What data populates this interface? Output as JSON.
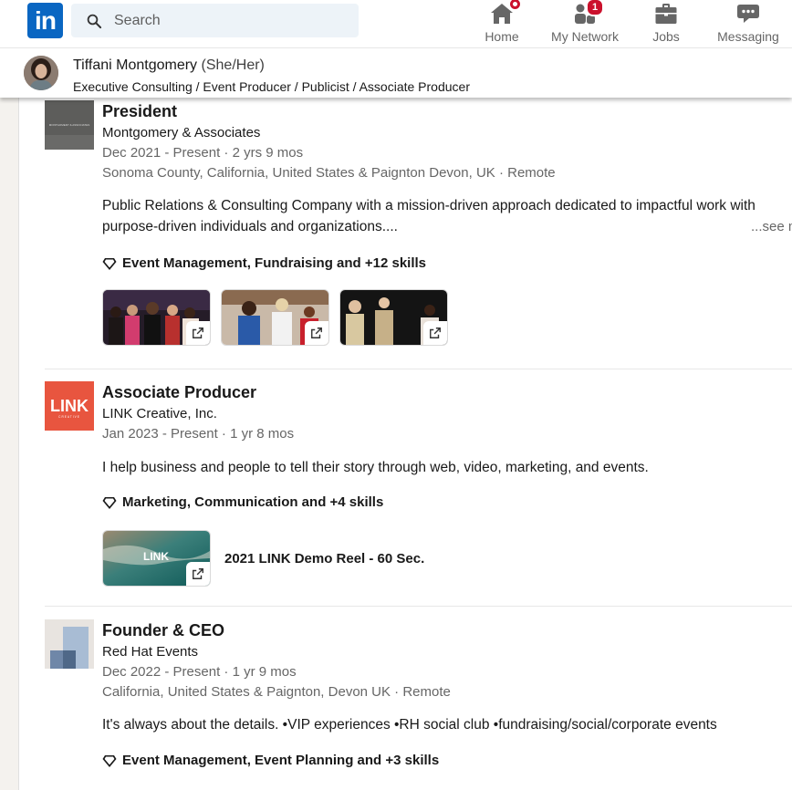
{
  "nav": {
    "logo_text": "in",
    "search_placeholder": "Search",
    "items": [
      {
        "label": "Home",
        "icon": "home-icon",
        "badge": ""
      },
      {
        "label": "My Network",
        "icon": "people-icon",
        "badge": "1"
      },
      {
        "label": "Jobs",
        "icon": "briefcase-icon",
        "badge": ""
      },
      {
        "label": "Messaging",
        "icon": "chat-icon",
        "badge": ""
      }
    ],
    "brand_color": "#0a66c2",
    "badge_color": "#cb112d"
  },
  "profile": {
    "name": "Tiffani Montgomery",
    "pronouns": "(She/Her)",
    "headline": "Executive Consulting / Event Producer / Publicist / Associate Producer"
  },
  "experience": [
    {
      "role": "President",
      "company": "Montgomery & Associates",
      "dates": "Dec 2021 - Present · 2 yrs 9 mos",
      "location": "Sonoma County, California, United States & Paignton Devon, UK · Remote",
      "description_line1": "Public Relations & Consulting Company with a mission-driven approach dedicated to impactful work with",
      "description_line2": "purpose-driven individuals and organizations....",
      "see_more": "...see m",
      "skills": "Event Management, Fundraising and +12 skills",
      "logo_text": "MONTGOMERY & ASSOCIATES"
    },
    {
      "role": "Associate Producer",
      "company": "LINK Creative, Inc.",
      "dates": "Jan 2023 - Present · 1 yr 8 mos",
      "description": "I help business and people to tell their story through web, video, marketing, and events.",
      "skills": "Marketing, Communication and +4 skills",
      "logo_text": "LINK",
      "logo_subtext": "CREATIVE",
      "media_title": "2021 LINK Demo Reel - 60 Sec.",
      "media_logo_text": "LINK"
    },
    {
      "role": "Founder & CEO",
      "company": "Red Hat Events",
      "dates": "Dec 2022 - Present · 1 yr 9 mos",
      "location": "California, United States & Paignton, Devon UK · Remote",
      "description": "It's always about the details. •VIP experiences •RH social club •fundraising/social/corporate events",
      "skills": "Event Management, Event Planning and +3 skills"
    }
  ]
}
